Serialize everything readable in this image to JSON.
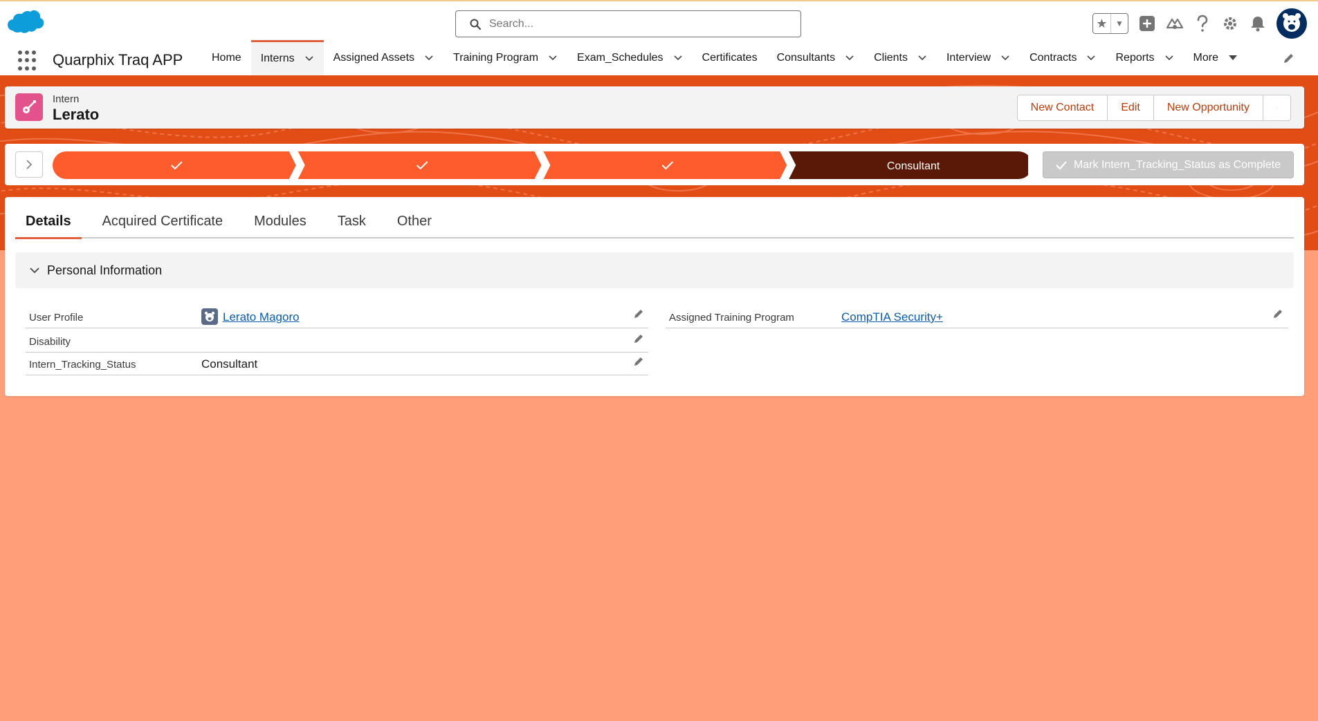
{
  "header": {
    "search_placeholder": "Search...",
    "icons": [
      "salesforce-cloud-icon",
      "search-icon",
      "favorites-star-icon",
      "chevron-down-icon",
      "global-create-icon",
      "trailhead-icon",
      "help-icon",
      "setup-gear-icon",
      "notifications-bell-icon",
      "user-avatar-icon"
    ]
  },
  "nav": {
    "app_name": "Quarphix Traq APP",
    "items": [
      {
        "label": "Home",
        "has_menu": false
      },
      {
        "label": "Interns",
        "has_menu": true,
        "active": true
      },
      {
        "label": "Assigned Assets",
        "has_menu": true
      },
      {
        "label": "Training Program",
        "has_menu": true
      },
      {
        "label": "Exam_Schedules",
        "has_menu": true
      },
      {
        "label": "Certificates",
        "has_menu": false
      },
      {
        "label": "Consultants",
        "has_menu": true
      },
      {
        "label": "Clients",
        "has_menu": true
      },
      {
        "label": "Interview",
        "has_menu": true
      },
      {
        "label": "Contracts",
        "has_menu": true
      },
      {
        "label": "Reports",
        "has_menu": true
      },
      {
        "label": "More",
        "has_menu": true
      }
    ]
  },
  "record": {
    "object_label": "Intern",
    "name": "Lerato",
    "actions": [
      "New Contact",
      "Edit",
      "New Opportunity"
    ]
  },
  "path": {
    "stages": [
      {
        "label": "",
        "status": "complete"
      },
      {
        "label": "",
        "status": "complete"
      },
      {
        "label": "",
        "status": "complete"
      },
      {
        "label": "Consultant",
        "status": "current"
      }
    ],
    "mark_complete_label": "Mark Intern_Tracking_Status as Complete"
  },
  "tabs": [
    "Details",
    "Acquired Certificate",
    "Modules",
    "Task",
    "Other"
  ],
  "section": {
    "title": "Personal Information"
  },
  "fields": {
    "user_profile": {
      "label": "User Profile",
      "value": "Lerato Magoro"
    },
    "disability": {
      "label": "Disability",
      "value": ""
    },
    "tracking_status": {
      "label": "Intern_Tracking_Status",
      "value": "Consultant"
    },
    "training_program": {
      "label": "Assigned Training Program",
      "value": "CompTIA Security+"
    }
  },
  "colors": {
    "brand_orange": "#e24d15",
    "path_complete": "#fe5c2c",
    "path_current": "#5a1807",
    "page_background": "#ff9e79",
    "link": "#0b5cab"
  }
}
